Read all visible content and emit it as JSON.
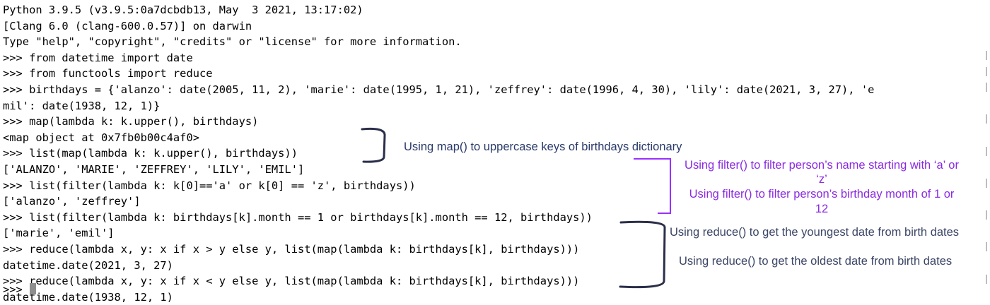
{
  "terminal": {
    "lines": [
      "Python 3.9.5 (v3.9.5:0a7dcbdb13, May  3 2021, 13:17:02)",
      "[Clang 6.0 (clang-600.0.57)] on darwin",
      "Type \"help\", \"copyright\", \"credits\" or \"license\" for more information.",
      ">>> from datetime import date",
      ">>> from functools import reduce",
      ">>> birthdays = {'alanzo': date(2005, 11, 2), 'marie': date(1995, 1, 21), 'zeffrey': date(1996, 4, 30), 'lily': date(2021, 3, 27), 'e",
      "mil': date(1938, 12, 1)}",
      ">>> map(lambda k: k.upper(), birthdays)",
      "<map object at 0x7fb0b00c4af0>",
      ">>> list(map(lambda k: k.upper(), birthdays))",
      "['ALANZO', 'MARIE', 'ZEFFREY', 'LILY', 'EMIL']",
      ">>> list(filter(lambda k: k[0]=='a' or k[0] == 'z', birthdays))",
      "['alanzo', 'zeffrey']",
      ">>> list(filter(lambda k: birthdays[k].month == 1 or birthdays[k].month == 12, birthdays))",
      "['marie', 'emil']",
      ">>> reduce(lambda x, y: x if x > y else y, list(map(lambda k: birthdays[k], birthdays)))",
      "datetime.date(2021, 3, 27)",
      ">>> reduce(lambda x, y: x if x < y else y, list(map(lambda k: birthdays[k], birthdays)))",
      "datetime.date(1938, 12, 1)",
      ">>> "
    ],
    "cursor_color": "#8e8e8e"
  },
  "annotations": {
    "map_note": "Using map() to uppercase keys of birthdays dictionary",
    "filter_name_note_line1": "Using filter() to filter person’s name starting with ‘a’ or",
    "filter_name_note_line2": "‘z’",
    "filter_month_note_line1": "Using filter() to filter person’s birthday month of  1 or",
    "filter_month_note_line2": "12",
    "reduce_youngest_note": "Using reduce() to get the youngest date from birth dates",
    "reduce_oldest_note": "Using reduce() to get the oldest date from birth dates"
  },
  "colors": {
    "text": "#000000",
    "bracket_dark": "#2b2f4a",
    "bracket_purple": "#9b30ff",
    "note_blue": "#2a3a6a",
    "note_purple": "#8a2be2"
  }
}
